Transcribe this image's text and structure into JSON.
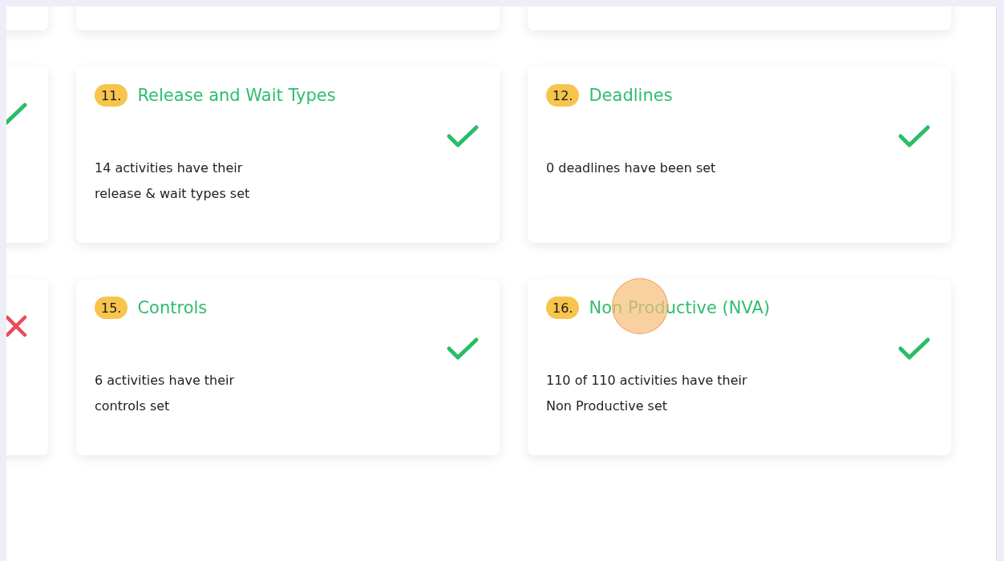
{
  "rows": [
    {
      "cards": [
        {
          "kind": "blank"
        },
        {
          "kind": "blank"
        },
        {
          "kind": "blank"
        }
      ]
    },
    {
      "cards": [
        {
          "kind": "step",
          "passed": true
        },
        {
          "kind": "step",
          "number": "11.",
          "title": "Release and Wait Types",
          "passed": true,
          "description": [
            "14 activities have their",
            "release & wait types set"
          ]
        },
        {
          "kind": "step",
          "number": "12.",
          "title": "Deadlines",
          "passed": true,
          "description": [
            "0 deadlines have been set"
          ]
        }
      ]
    },
    {
      "cards": [
        {
          "kind": "step",
          "passed": false
        },
        {
          "kind": "step",
          "number": "15.",
          "title": "Controls",
          "passed": true,
          "description": [
            "6 activities have their",
            "controls set"
          ]
        },
        {
          "kind": "step",
          "number": "16.",
          "title": "Non Productive (NVA)",
          "passed": true,
          "cursor_marker": true,
          "description": [
            "110 of 110 activities have their",
            "Non Productive set"
          ]
        }
      ]
    }
  ]
}
